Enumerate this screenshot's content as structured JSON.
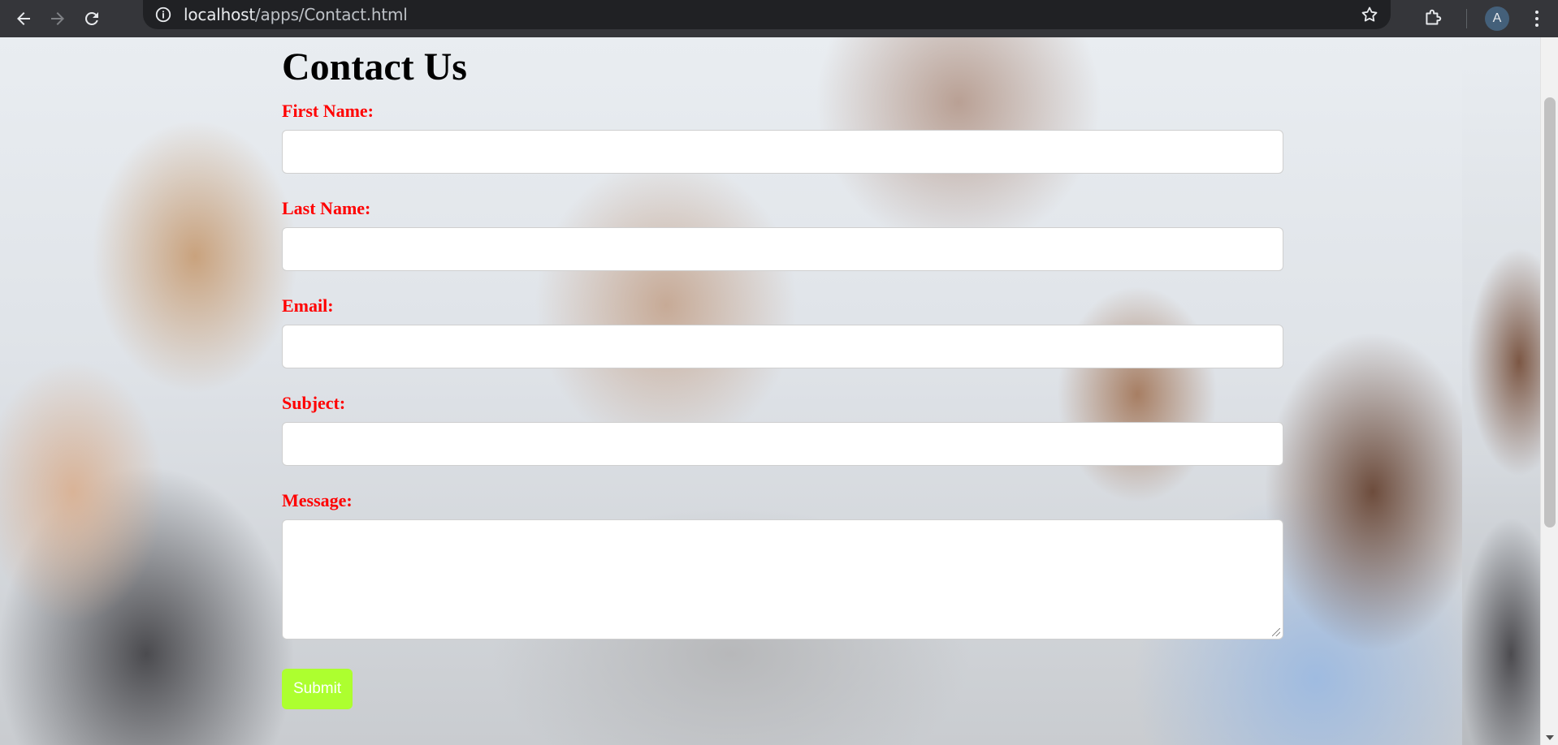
{
  "browser": {
    "url_host": "localhost",
    "url_path": "/apps/Contact.html",
    "avatar_letter": "A",
    "icons": {
      "back": "back-arrow-icon",
      "forward": "forward-arrow-icon",
      "reload": "reload-icon",
      "site_info": "info-icon",
      "bookmark": "star-icon",
      "extensions": "puzzle-icon",
      "menu": "kebab-menu-icon"
    }
  },
  "page": {
    "title": "Contact Us",
    "fields": {
      "first_name": {
        "label": "First Name:",
        "value": ""
      },
      "last_name": {
        "label": "Last Name:",
        "value": ""
      },
      "email": {
        "label": "Email:",
        "value": ""
      },
      "subject": {
        "label": "Subject:",
        "value": ""
      },
      "message": {
        "label": "Message:",
        "value": ""
      }
    },
    "submit_label": "Submit"
  },
  "colors": {
    "label_color": "#ff0000",
    "submit_bg": "#adff2f",
    "chrome_bg": "#35363a",
    "omnibox_bg": "#202124"
  }
}
